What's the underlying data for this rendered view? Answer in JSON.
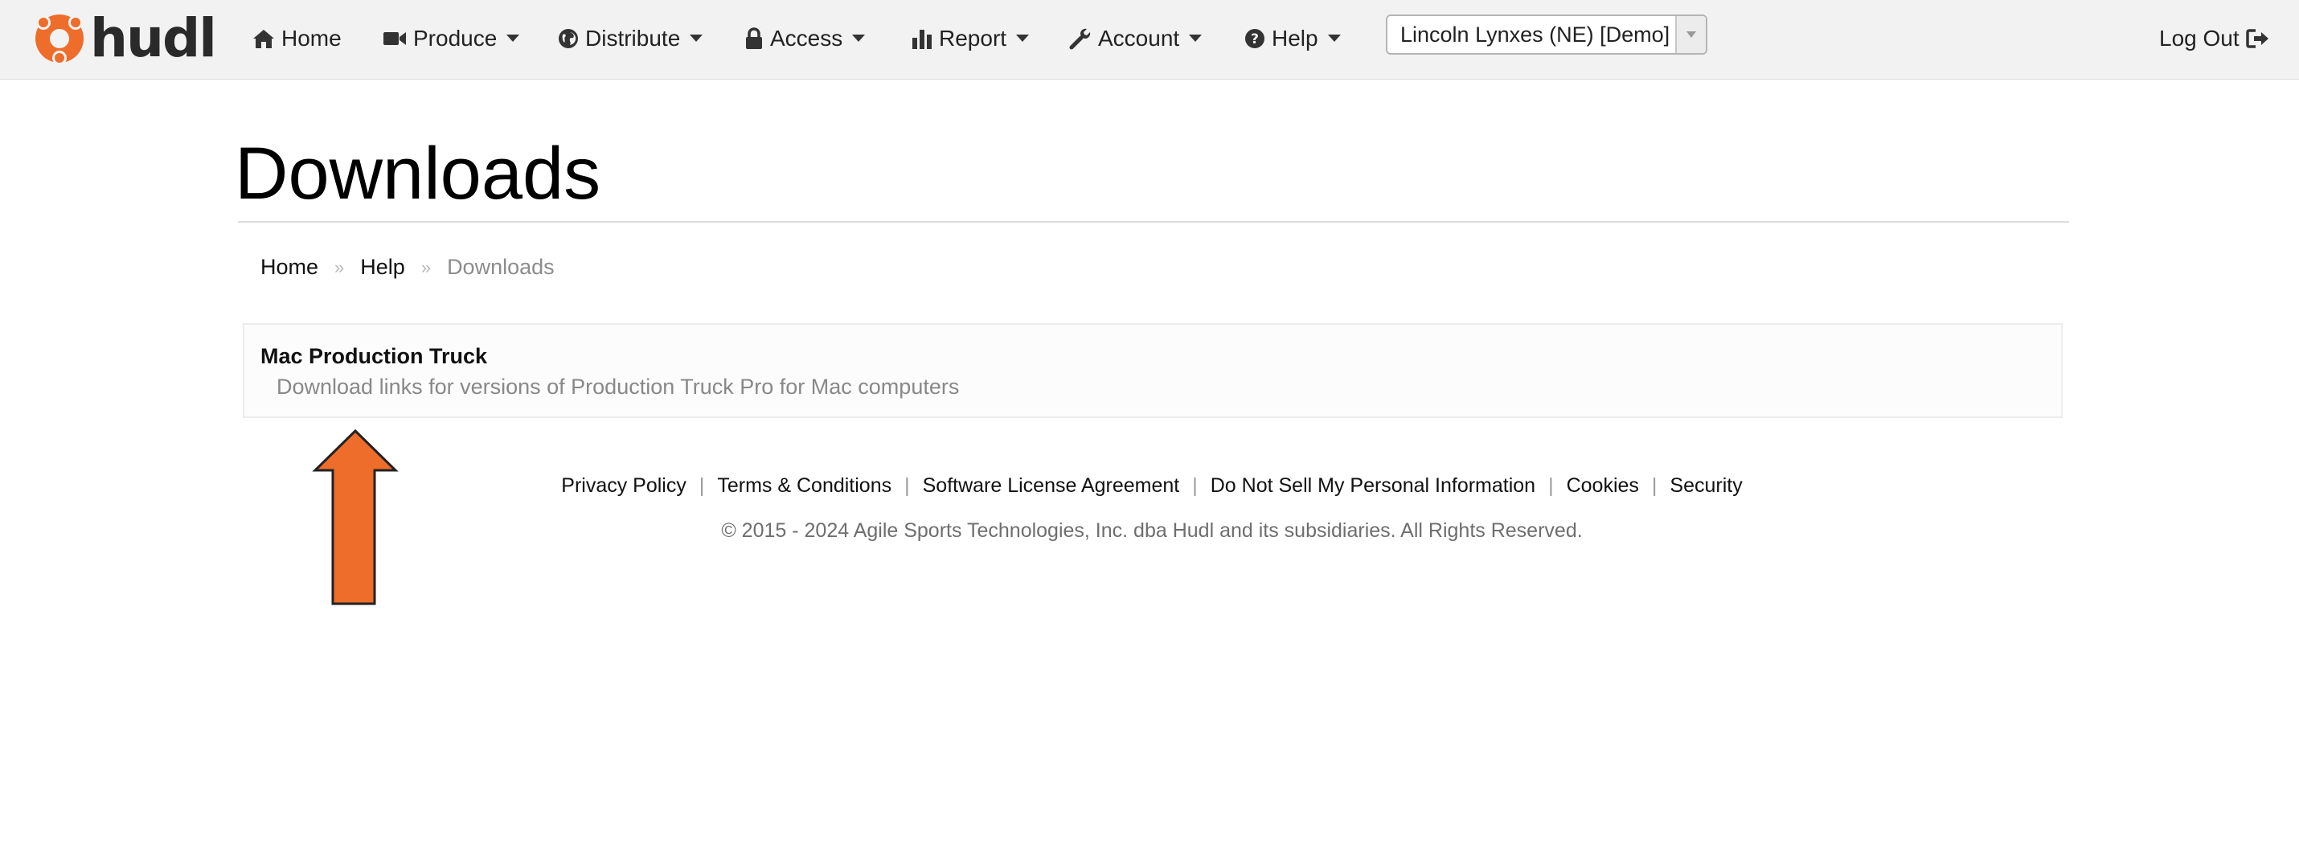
{
  "brand": {
    "name": "hudl",
    "accent": "#ee6d2b"
  },
  "nav": {
    "items": [
      {
        "label": "Home",
        "icon": "home-icon"
      },
      {
        "label": "Produce",
        "icon": "video-camera-icon"
      },
      {
        "label": "Distribute",
        "icon": "globe-icon"
      },
      {
        "label": "Access",
        "icon": "lock-icon"
      },
      {
        "label": "Report",
        "icon": "bar-chart-icon"
      },
      {
        "label": "Account",
        "icon": "wrench-icon"
      },
      {
        "label": "Help",
        "icon": "question-circle-icon"
      }
    ],
    "team_select": "Lincoln Lynxes (NE) [Demo]",
    "logout": "Log Out"
  },
  "page": {
    "title": "Downloads",
    "breadcrumb": [
      "Home",
      "Help",
      "Downloads"
    ],
    "breadcrumb_separator": "»"
  },
  "downloads": [
    {
      "title": "Mac Production Truck",
      "description": "Download links for versions of Production Truck Pro for Mac computers"
    }
  ],
  "footer": {
    "links": [
      "Privacy Policy",
      "Terms & Conditions",
      "Software License Agreement",
      "Do Not Sell My Personal Information",
      "Cookies",
      "Security"
    ],
    "separator": "|",
    "copyright": "© 2015 - 2024 Agile Sports Technologies, Inc. dba Hudl and its subsidiaries. All Rights Reserved."
  }
}
